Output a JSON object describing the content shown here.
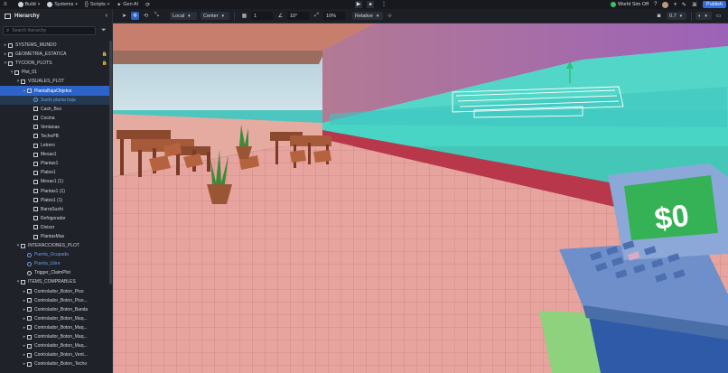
{
  "topbar": {
    "build": "Build",
    "systems": "Systems",
    "scripts": "Scripts",
    "gen_ai": "Gen AI",
    "world_sim": "World Sim Off",
    "publish": "Publish",
    "play_icon": "play-icon",
    "stop_icon": "stop-icon"
  },
  "hierarchy": {
    "title": "Hierarchy",
    "search_placeholder": "Search hierarchy",
    "rows": [
      {
        "label": "SYSTEMS_MUNDO",
        "depth": 0,
        "caret": "›",
        "lock": ""
      },
      {
        "label": "GEOMETRIA_ESTATICA",
        "depth": 0,
        "caret": "›",
        "lock": "🔒"
      },
      {
        "label": "TYCOON_PLOTS",
        "depth": 0,
        "caret": "⌄",
        "lock": "🔒"
      },
      {
        "label": "Plot_01",
        "depth": 1,
        "caret": "⌄",
        "lock": ""
      },
      {
        "label": "VISUALES_PLOT",
        "depth": 2,
        "caret": "⌄",
        "lock": ""
      },
      {
        "label": "PlantaBajaObjetos",
        "depth": 3,
        "caret": "⌄",
        "lock": "",
        "selected": true
      },
      {
        "label": "Suelo planta baja",
        "depth": 4,
        "caret": "",
        "lock": "",
        "blue": true,
        "hl": true,
        "gear": true
      },
      {
        "label": "Cash_Box",
        "depth": 4,
        "caret": "",
        "lock": ""
      },
      {
        "label": "Cocina",
        "depth": 4,
        "caret": "",
        "lock": ""
      },
      {
        "label": "Ventanas",
        "depth": 4,
        "caret": "",
        "lock": ""
      },
      {
        "label": "TechoPB",
        "depth": 4,
        "caret": "",
        "lock": ""
      },
      {
        "label": "Letrero",
        "depth": 4,
        "caret": "",
        "lock": ""
      },
      {
        "label": "Mesas1",
        "depth": 4,
        "caret": "",
        "lock": ""
      },
      {
        "label": "Plantas1",
        "depth": 4,
        "caret": "",
        "lock": ""
      },
      {
        "label": "Platos1",
        "depth": 4,
        "caret": "",
        "lock": ""
      },
      {
        "label": "Mesas1 (1)",
        "depth": 4,
        "caret": "",
        "lock": ""
      },
      {
        "label": "Plantas1 (1)",
        "depth": 4,
        "caret": "",
        "lock": ""
      },
      {
        "label": "Platos1 (1)",
        "depth": 4,
        "caret": "",
        "lock": ""
      },
      {
        "label": "BarraSushi",
        "depth": 4,
        "caret": "",
        "lock": ""
      },
      {
        "label": "Refrigerador",
        "depth": 4,
        "caret": "",
        "lock": ""
      },
      {
        "label": "Divisor",
        "depth": 4,
        "caret": "",
        "lock": ""
      },
      {
        "label": "PlantasMas",
        "depth": 4,
        "caret": "",
        "lock": ""
      },
      {
        "label": "INTERACCIONES_PLOT",
        "depth": 2,
        "caret": "⌄",
        "lock": ""
      },
      {
        "label": "Puerta_Ocupada",
        "depth": 3,
        "caret": "",
        "lock": "",
        "blue": true,
        "gear": true
      },
      {
        "label": "Puerta_Libre",
        "depth": 3,
        "caret": "",
        "lock": "",
        "blue": true,
        "gear": true
      },
      {
        "label": "Trigger_ClaimPlot",
        "depth": 3,
        "caret": "",
        "lock": "",
        "gear": true
      },
      {
        "label": "ITEMS_COMPRABLES",
        "depth": 2,
        "caret": "⌄",
        "lock": ""
      },
      {
        "label": "Controlador_Boton_Piso",
        "depth": 3,
        "caret": "›",
        "lock": ""
      },
      {
        "label": "Controlador_Boton_Piso...",
        "depth": 3,
        "caret": "›",
        "lock": ""
      },
      {
        "label": "Controlador_Boton_Banda",
        "depth": 3,
        "caret": "›",
        "lock": ""
      },
      {
        "label": "Controlador_Boton_Maq...",
        "depth": 3,
        "caret": "›",
        "lock": ""
      },
      {
        "label": "Controlador_Boton_Maq...",
        "depth": 3,
        "caret": "›",
        "lock": ""
      },
      {
        "label": "Controlador_Boton_Maq...",
        "depth": 3,
        "caret": "›",
        "lock": ""
      },
      {
        "label": "Controlador_Boton_Maq...",
        "depth": 3,
        "caret": "›",
        "lock": ""
      },
      {
        "label": "Controlador_Boton_Vent...",
        "depth": 3,
        "caret": "›",
        "lock": ""
      },
      {
        "label": "Controlador_Boton_Techo",
        "depth": 3,
        "caret": "›",
        "lock": ""
      }
    ]
  },
  "toolbar": {
    "space": "Local",
    "pivot": "Center",
    "snap_move": "1",
    "snap_rotate": "10°",
    "snap_scale": "10%",
    "relative": "Relative",
    "zoom": "0.7"
  },
  "viewport": {
    "cash_display": "$0"
  }
}
